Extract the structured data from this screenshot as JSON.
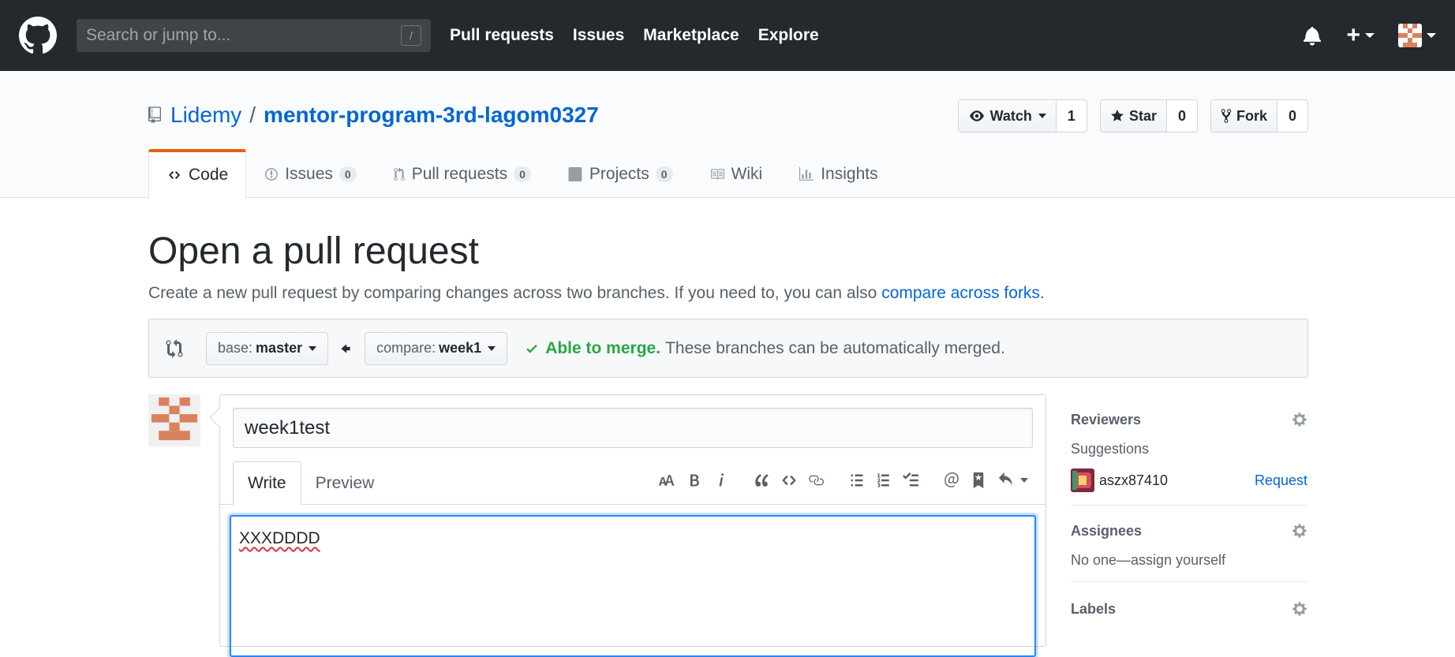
{
  "header": {
    "search_placeholder": "Search or jump to...",
    "search_shortcut": "/",
    "nav": [
      "Pull requests",
      "Issues",
      "Marketplace",
      "Explore"
    ],
    "plus": "+"
  },
  "repo": {
    "owner": "Lidemy",
    "separator": "/",
    "name": "mentor-program-3rd-lagom0327",
    "watch_label": "Watch",
    "watch_count": "1",
    "star_label": "Star",
    "star_count": "0",
    "fork_label": "Fork",
    "fork_count": "0",
    "tabs": [
      {
        "label": "Code",
        "count": null
      },
      {
        "label": "Issues",
        "count": "0"
      },
      {
        "label": "Pull requests",
        "count": "0"
      },
      {
        "label": "Projects",
        "count": "0"
      },
      {
        "label": "Wiki",
        "count": null
      },
      {
        "label": "Insights",
        "count": null
      }
    ]
  },
  "page": {
    "title": "Open a pull request",
    "subtitle": "Create a new pull request by comparing changes across two branches. If you need to, you can also ",
    "subtitle_link": "compare across forks",
    "subtitle_end": "."
  },
  "range": {
    "base_key": "base:",
    "base_value": "master",
    "compare_key": "compare:",
    "compare_value": "week1",
    "merge_ok": "Able to merge.",
    "merge_text": "These branches can be automatically merged."
  },
  "form": {
    "title_value": "week1test",
    "tab_write": "Write",
    "tab_preview": "Preview",
    "body_value": "XXXDDDD"
  },
  "sidebar": {
    "reviewers_label": "Reviewers",
    "suggestions_label": "Suggestions",
    "reviewer_name": "aszx87410",
    "request_label": "Request",
    "assignees_label": "Assignees",
    "assignees_text": "No one—assign yourself",
    "labels_label": "Labels"
  },
  "colors": {
    "header_bg": "#24292e",
    "link": "#0366d6",
    "success": "#28a745",
    "tab_accent": "#e36209"
  }
}
